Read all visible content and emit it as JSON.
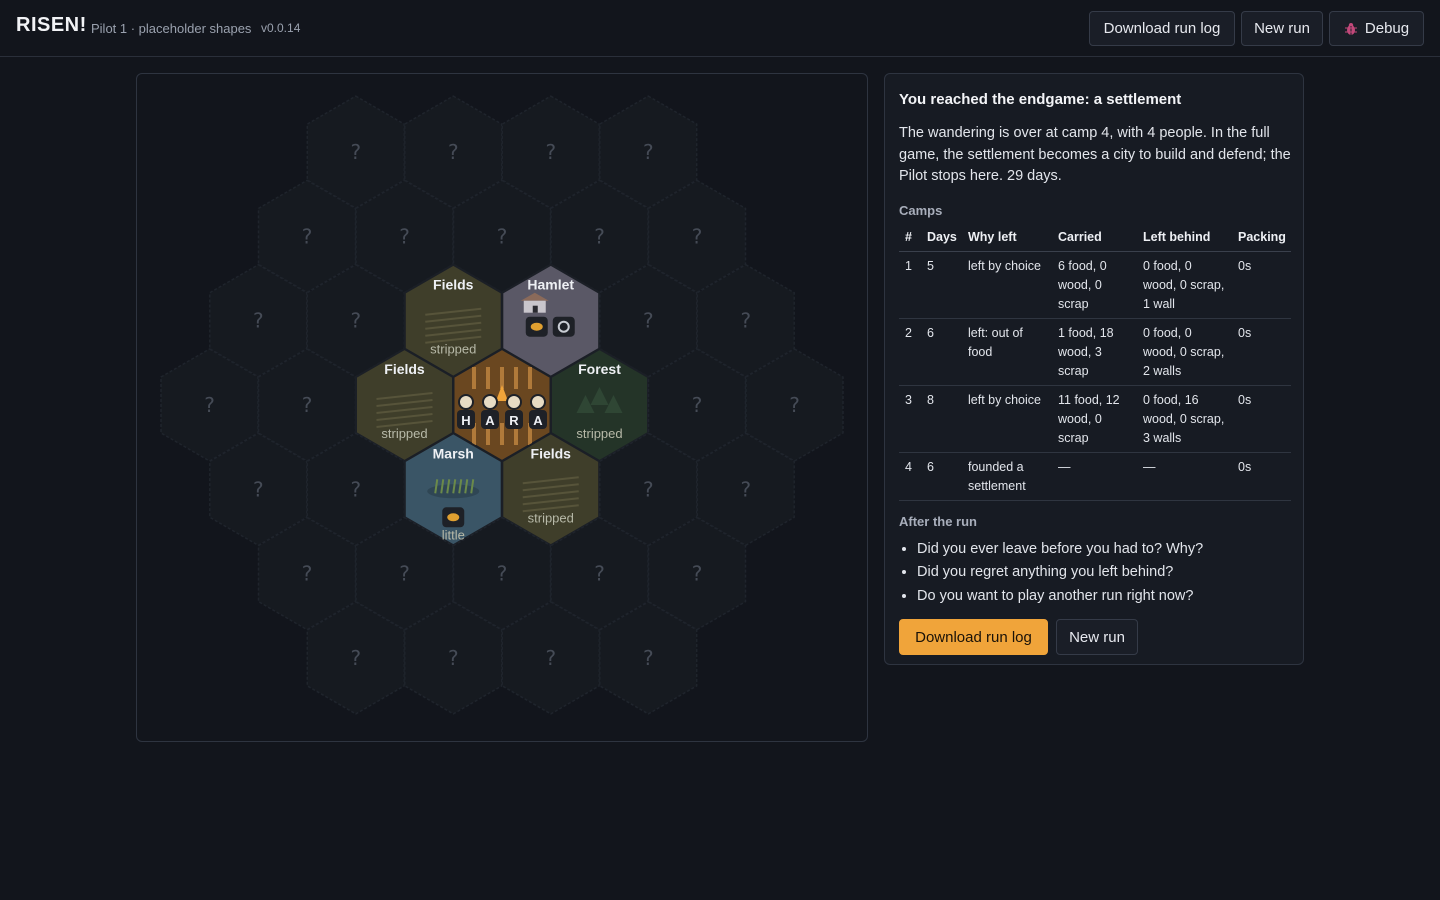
{
  "header": {
    "title": "RISEN!",
    "subtitle": "Pilot 1 · placeholder shapes",
    "version": "v0.0.14",
    "download_label": "Download run log",
    "new_run_label": "New run",
    "debug_label": "Debug"
  },
  "map": {
    "unknown_label": "?",
    "center_letters": [
      "H",
      "A",
      "R",
      "A"
    ],
    "tiles": [
      {
        "name": "Fields",
        "status": "stripped",
        "type": "fields"
      },
      {
        "name": "Hamlet",
        "status": "",
        "type": "hamlet"
      },
      {
        "name": "Fields",
        "status": "stripped",
        "type": "fields"
      },
      {
        "name": "Forest",
        "status": "stripped",
        "type": "forest"
      },
      {
        "name": "Marsh",
        "status": "little",
        "type": "marsh"
      },
      {
        "name": "Fields",
        "status": "stripped",
        "type": "fields"
      }
    ],
    "colors": {
      "fields": "#3f3e2a",
      "hamlet": "#5a5866",
      "forest": "#243428",
      "marsh": "#3a5566",
      "camp": "#6a4720",
      "unknown": "#161a20"
    }
  },
  "summary": {
    "heading": "You reached the endgame: a settlement",
    "intro": "The wandering is over at camp 4, with 4 people. In the full game, the settlement becomes a city to build and defend; the Pilot stops here. 29 days.",
    "camps_label": "Camps",
    "columns": [
      "#",
      "Days",
      "Why left",
      "Carried",
      "Left behind",
      "Packing"
    ],
    "rows": [
      [
        "1",
        "5",
        "left by choice",
        "6 food, 0 wood, 0 scrap",
        "0 food, 0 wood, 0 scrap, 1 wall",
        "0s"
      ],
      [
        "2",
        "6",
        "left: out of food",
        "1 food, 18 wood, 3 scrap",
        "0 food, 0 wood, 0 scrap, 2 walls",
        "0s"
      ],
      [
        "3",
        "8",
        "left by choice",
        "11 food, 12 wood, 0 scrap",
        "0 food, 16 wood, 0 scrap, 3 walls",
        "0s"
      ],
      [
        "4",
        "6",
        "founded a settlement",
        "—",
        "—",
        "0s"
      ]
    ],
    "after_label": "After the run",
    "questions": [
      "Did you ever leave before you had to? Why?",
      "Did you regret anything you left behind?",
      "Do you want to play another run right now?"
    ],
    "download_label": "Download run log",
    "new_run_label": "New run"
  }
}
